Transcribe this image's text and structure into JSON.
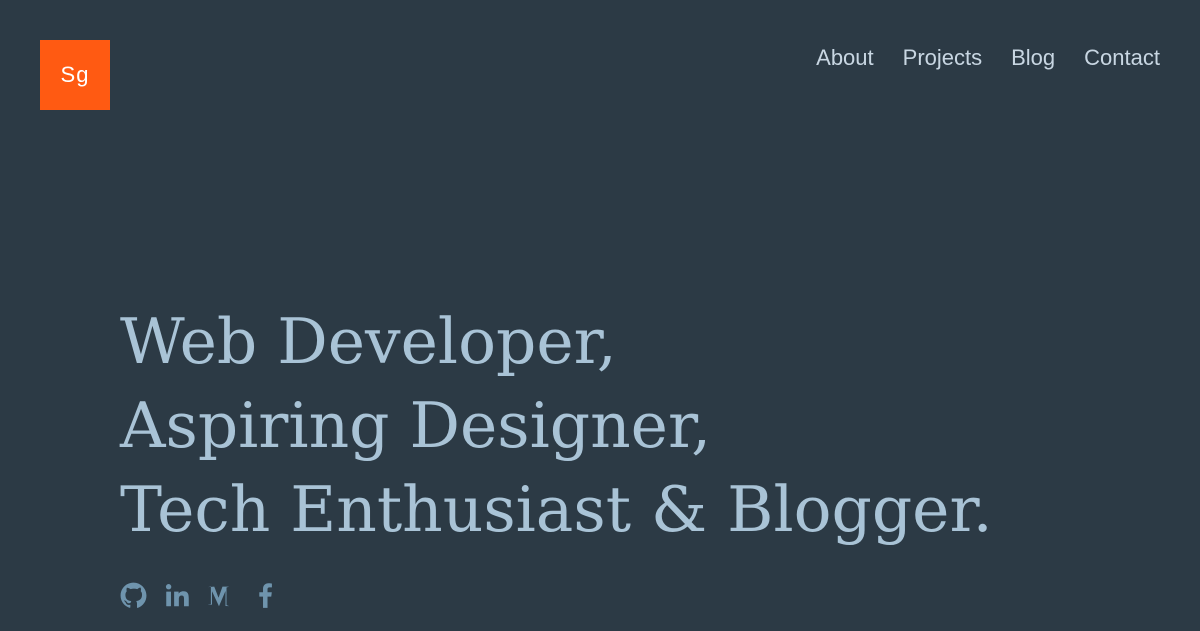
{
  "header": {
    "logo_text": "Sg",
    "nav": [
      {
        "label": "About"
      },
      {
        "label": "Projects"
      },
      {
        "label": "Blog"
      },
      {
        "label": "Contact"
      }
    ]
  },
  "hero": {
    "lines": [
      "Web Developer,",
      "Aspiring Designer,",
      "Tech Enthusiast & Blogger."
    ]
  },
  "social": {
    "icons": [
      "github-icon",
      "linkedin-icon",
      "medium-icon",
      "facebook-icon"
    ]
  },
  "colors": {
    "background": "#2c3a45",
    "logo_bg": "#ff5a12",
    "nav_text": "#c8d6e2",
    "hero_text": "#a9c3d6",
    "social_icon": "#6f94ad"
  }
}
